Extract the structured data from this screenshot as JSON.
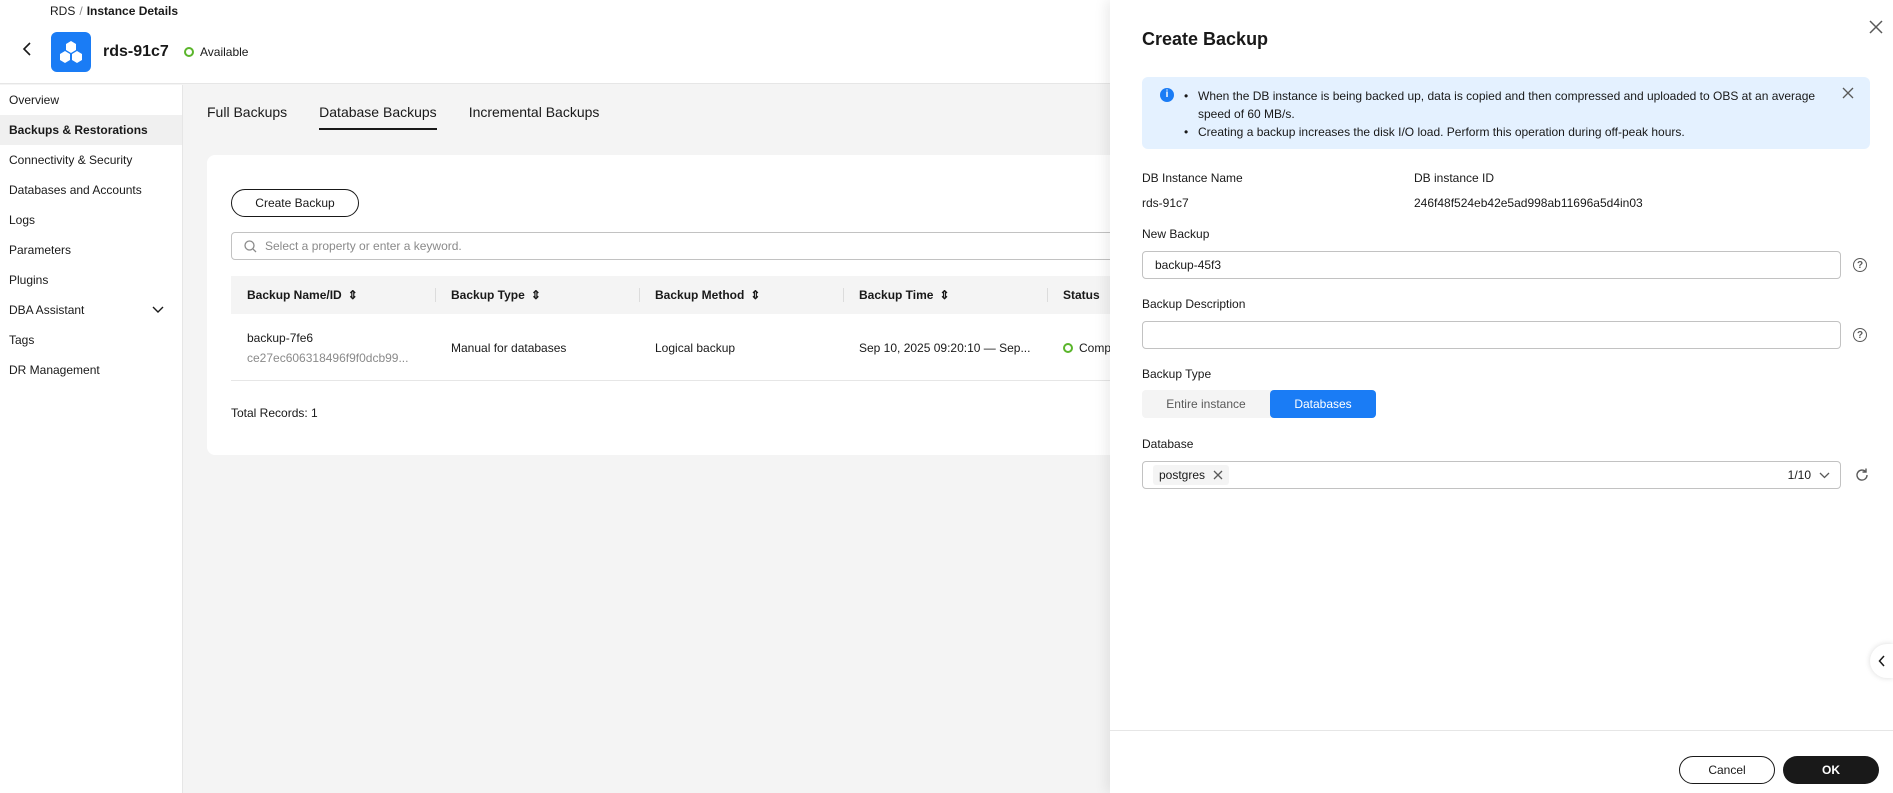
{
  "breadcrumb": {
    "root": "RDS",
    "separator": "/",
    "current": "Instance Details"
  },
  "instance": {
    "name": "rds-91c7",
    "status": "Available"
  },
  "sidebar": {
    "items": [
      {
        "label": "Overview"
      },
      {
        "label": "Backups & Restorations"
      },
      {
        "label": "Connectivity & Security"
      },
      {
        "label": "Databases and Accounts"
      },
      {
        "label": "Logs"
      },
      {
        "label": "Parameters"
      },
      {
        "label": "Plugins"
      },
      {
        "label": "DBA Assistant"
      },
      {
        "label": "Tags"
      },
      {
        "label": "DR Management"
      }
    ]
  },
  "tabs": [
    {
      "label": "Full Backups"
    },
    {
      "label": "Database Backups"
    },
    {
      "label": "Incremental Backups"
    }
  ],
  "main": {
    "create_button": "Create Backup",
    "search_placeholder": "Select a property or enter a keyword.",
    "columns": [
      "Backup Name/ID",
      "Backup Type",
      "Backup Method",
      "Backup Time",
      "Status"
    ],
    "rows": [
      {
        "name": "backup-7fe6",
        "id": "ce27ec606318496f9f0dcb99...",
        "type": "Manual for databases",
        "method": "Logical backup",
        "time": "Sep 10, 2025 09:20:10 — Sep...",
        "status": "Comp"
      }
    ],
    "total": "Total Records: 1"
  },
  "drawer": {
    "title": "Create Backup",
    "alert": [
      "When the DB instance is being backed up, data is copied and then compressed and uploaded to OBS at an average speed of 60 MB/s.",
      "Creating a backup increases the disk I/O load. Perform this operation during off-peak hours."
    ],
    "instance_name_label": "DB Instance Name",
    "instance_name_value": "rds-91c7",
    "instance_id_label": "DB instance ID",
    "instance_id_value": "246f48f524eb42e5ad998ab11696a5d4in03",
    "new_backup_label": "New Backup",
    "new_backup_value": "backup-45f3",
    "description_label": "Backup Description",
    "description_value": "",
    "backup_type_label": "Backup Type",
    "backup_type_options": [
      "Entire instance",
      "Databases"
    ],
    "backup_type_selected": "Databases",
    "database_label": "Database",
    "database_tag": "postgres",
    "database_count": "1/10",
    "cancel": "Cancel",
    "ok": "OK"
  },
  "colors": {
    "accent": "#1a7cf5",
    "success": "#5ab52b",
    "alert_bg": "#e4f1ff",
    "primary_dark": "#191919"
  }
}
